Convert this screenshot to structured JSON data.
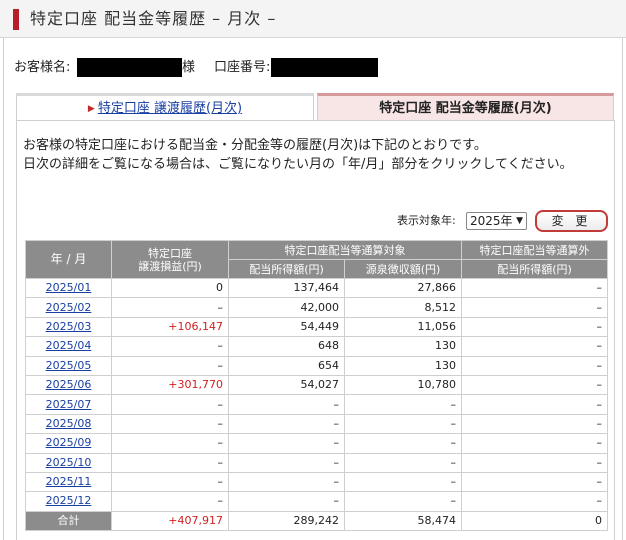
{
  "header": {
    "title": "特定口座 配当金等履歴 – 月次 –"
  },
  "customer": {
    "name_label": "お客様名:",
    "name_suffix": "様",
    "account_label": "口座番号:"
  },
  "tabs": [
    {
      "label": "特定口座 譲渡履歴(月次)",
      "active": false
    },
    {
      "label": "特定口座 配当金等履歴(月次)",
      "active": true
    }
  ],
  "description": [
    "お客様の特定口座における配当金・分配金等の履歴(月次)は下記のとおりです。",
    "日次の詳細をご覧になる場合は、ご覧になりたい月の「年/月」部分をクリックしてください。"
  ],
  "filter": {
    "label": "表示対象年:",
    "year": "2025年",
    "change_button": "変 更"
  },
  "table": {
    "headers": {
      "month": "年 / 月",
      "transfer": [
        "特定口座",
        "譲渡損益(円)"
      ],
      "taxable_group": "特定口座配当等通算対象",
      "dividend": "配当所得額(円)",
      "withholding": "源泉徴収額(円)",
      "non_group": "特定口座配当等通算外",
      "non_dividend": "配当所得額(円)"
    },
    "rows": [
      {
        "month": "2025/01",
        "transfer": "0",
        "dividend": "137,464",
        "withholding": "27,866",
        "non": "–"
      },
      {
        "month": "2025/02",
        "transfer": "–",
        "dividend": "42,000",
        "withholding": "8,512",
        "non": "–"
      },
      {
        "month": "2025/03",
        "transfer": "+106,147",
        "dividend": "54,449",
        "withholding": "11,056",
        "non": "–"
      },
      {
        "month": "2025/04",
        "transfer": "–",
        "dividend": "648",
        "withholding": "130",
        "non": "–"
      },
      {
        "month": "2025/05",
        "transfer": "–",
        "dividend": "654",
        "withholding": "130",
        "non": "–"
      },
      {
        "month": "2025/06",
        "transfer": "+301,770",
        "dividend": "54,027",
        "withholding": "10,780",
        "non": "–"
      },
      {
        "month": "2025/07",
        "transfer": "–",
        "dividend": "–",
        "withholding": "–",
        "non": "–"
      },
      {
        "month": "2025/08",
        "transfer": "–",
        "dividend": "–",
        "withholding": "–",
        "non": "–"
      },
      {
        "month": "2025/09",
        "transfer": "–",
        "dividend": "–",
        "withholding": "–",
        "non": "–"
      },
      {
        "month": "2025/10",
        "transfer": "–",
        "dividend": "–",
        "withholding": "–",
        "non": "–"
      },
      {
        "month": "2025/11",
        "transfer": "–",
        "dividend": "–",
        "withholding": "–",
        "non": "–"
      },
      {
        "month": "2025/12",
        "transfer": "–",
        "dividend": "–",
        "withholding": "–",
        "non": "–"
      }
    ],
    "total": {
      "label": "合計",
      "transfer": "+407,917",
      "dividend": "289,242",
      "withholding": "58,474",
      "non": "0"
    }
  },
  "colors": {
    "accent": "#b81b2a",
    "header_bg": "#8c8c8c",
    "link": "#1a3fa3",
    "gain": "#d02020",
    "active_tab": "#f8e6e6"
  }
}
